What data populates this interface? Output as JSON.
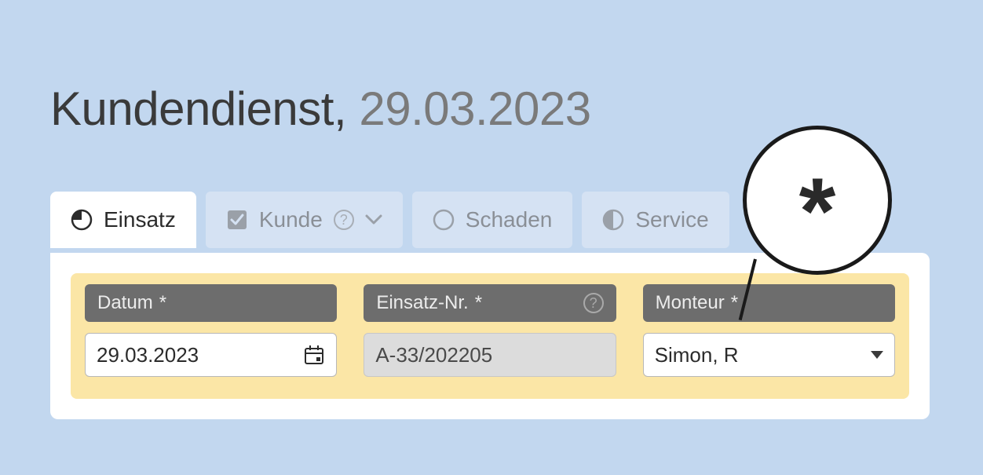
{
  "header": {
    "title_prefix": "Kundendienst,",
    "title_date": "29.03.2023"
  },
  "tabs": {
    "einsatz": {
      "label": "Einsatz"
    },
    "kunde": {
      "label": "Kunde"
    },
    "schaden": {
      "label": "Schaden"
    },
    "service": {
      "label": "Service"
    }
  },
  "fields": {
    "datum": {
      "label": "Datum",
      "required_mark": "*",
      "value": "29.03.2023"
    },
    "einsatz_nr": {
      "label": "Einsatz-Nr.",
      "required_mark": "*",
      "value": "A-33/202205"
    },
    "monteur": {
      "label": "Monteur",
      "required_mark": "*",
      "value": "Simon, R"
    }
  },
  "callout": {
    "symbol": "*"
  }
}
